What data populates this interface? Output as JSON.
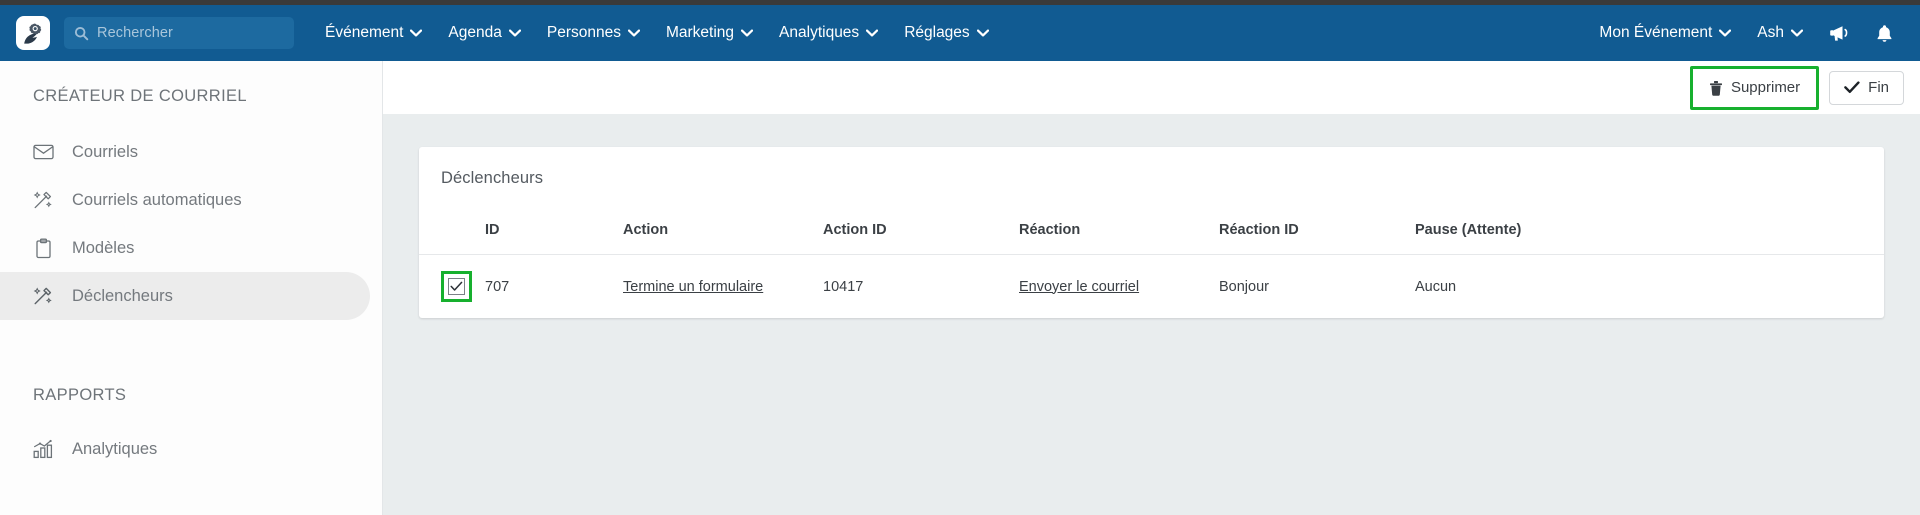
{
  "navbar": {
    "logo_icon": "bird-flower-logo-icon",
    "search": {
      "placeholder": "Rechercher",
      "value": "",
      "icon": "search-icon"
    },
    "menu": [
      {
        "label": "Événement",
        "icon": "chevron-down-icon"
      },
      {
        "label": "Agenda",
        "icon": "chevron-down-icon"
      },
      {
        "label": "Personnes",
        "icon": "chevron-down-icon"
      },
      {
        "label": "Marketing",
        "icon": "chevron-down-icon"
      },
      {
        "label": "Analytiques",
        "icon": "chevron-down-icon"
      },
      {
        "label": "Réglages",
        "icon": "chevron-down-icon"
      }
    ],
    "right": {
      "event_label": "Mon Événement",
      "user_label": "Ash",
      "announce_icon": "megaphone-icon",
      "notifications_icon": "bell-icon"
    },
    "background_color": "#115b92"
  },
  "sidebar": {
    "section_1_title": "CRÉATEUR DE COURRIEL",
    "items": [
      {
        "label": "Courriels",
        "icon": "envelope-icon",
        "active": false
      },
      {
        "label": "Courriels automatiques",
        "icon": "magic-wand-icon",
        "active": false
      },
      {
        "label": "Modèles",
        "icon": "clipboard-icon",
        "active": false
      },
      {
        "label": "Déclencheurs",
        "icon": "magic-wand-icon",
        "active": true
      }
    ],
    "section_2_title": "RAPPORTS",
    "items_2": [
      {
        "label": "Analytiques",
        "icon": "bar-chart-icon",
        "active": false
      }
    ]
  },
  "toolbar": {
    "delete_label": "Supprimer",
    "delete_icon": "trash-icon",
    "done_label": "Fin",
    "done_icon": "check-icon",
    "highlight_color": "#17b02e"
  },
  "card": {
    "title": "Déclencheurs",
    "columns": [
      "ID",
      "Action",
      "Action ID",
      "Réaction",
      "Réaction ID",
      "Pause (Attente)"
    ],
    "rows": [
      {
        "selected": true,
        "id": "707",
        "action": "Termine un formulaire",
        "action_id": "10417",
        "reaction": "Envoyer le courriel",
        "reaction_id": "Bonjour",
        "pause": "Aucun"
      }
    ]
  }
}
